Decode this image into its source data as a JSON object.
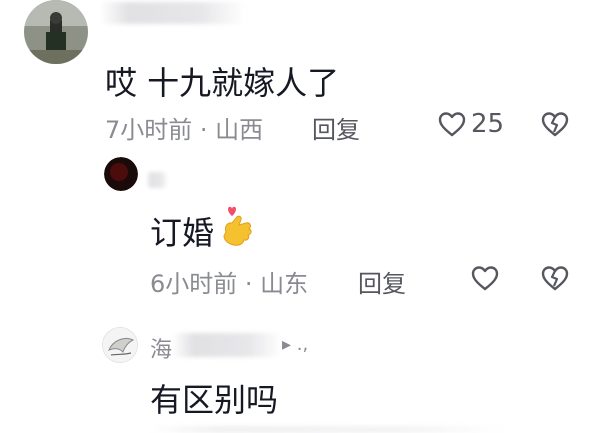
{
  "comments": [
    {
      "username": "",
      "text": "哎   十九就嫁人了",
      "time": "7小时前",
      "location": "山西",
      "reply_label": "回复",
      "like_count": "25"
    },
    {
      "username": "",
      "text": "订婚",
      "emoji": "🫰",
      "time": "6小时前",
      "location": "山东",
      "reply_label": "回复",
      "like_count": ""
    },
    {
      "username": "海",
      "username_suffix": "▸ .,",
      "text": "有区别吗",
      "time": "",
      "location": "",
      "reply_label": "",
      "like_count": ""
    }
  ],
  "colors": {
    "primary_text": "#161823",
    "secondary_text": "#8a8b91",
    "heart_emoji": "#f0506e",
    "hand_emoji": "#f5c12f"
  }
}
